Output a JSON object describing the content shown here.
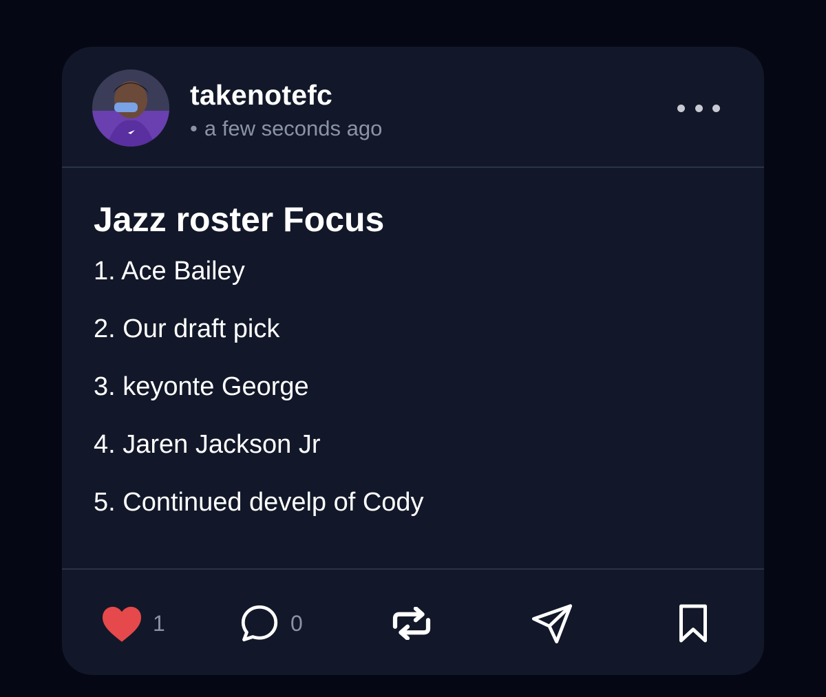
{
  "post": {
    "username": "takenotefc",
    "timestamp": "a few seconds ago",
    "title": "Jazz roster Focus",
    "items": [
      "1. Ace Bailey",
      "2. Our draft pick",
      "3. keyonte George",
      "4. Jaren Jackson Jr",
      "5. Continued develp of Cody"
    ]
  },
  "actions": {
    "like_count": "1",
    "comment_count": "0"
  },
  "colors": {
    "background": "#050814",
    "card": "#121829",
    "like": "#e5494b",
    "muted_text": "#8c93a6"
  },
  "icons": {
    "more": "more-horizontal-icon",
    "like": "heart-icon",
    "comment": "comment-bubble-icon",
    "repost": "repost-icon",
    "share": "send-icon",
    "bookmark": "bookmark-icon"
  }
}
